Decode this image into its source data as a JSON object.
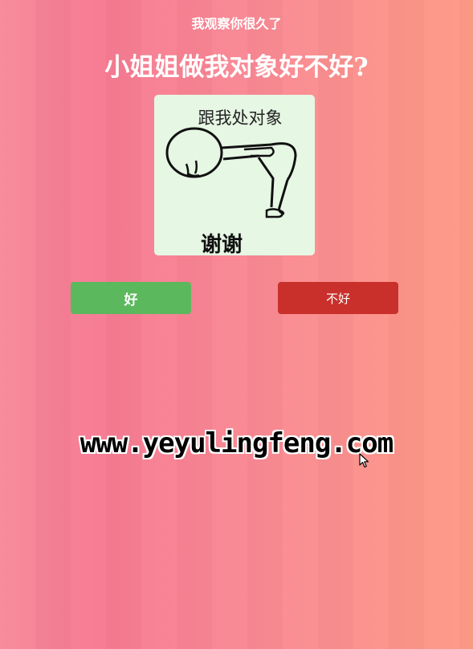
{
  "header": {
    "subtitle": "我观察你很久了",
    "title": "小姐姐做我对象好不好?"
  },
  "meme": {
    "top_text": "跟我处对象",
    "bottom_text": "谢谢"
  },
  "buttons": {
    "yes_label": "好",
    "no_label": "不好"
  },
  "watermark": "www.yeyulingfeng.com",
  "colors": {
    "yes": "#5cb85c",
    "no": "#c9302c",
    "meme_bg": "#e6f7e4"
  }
}
